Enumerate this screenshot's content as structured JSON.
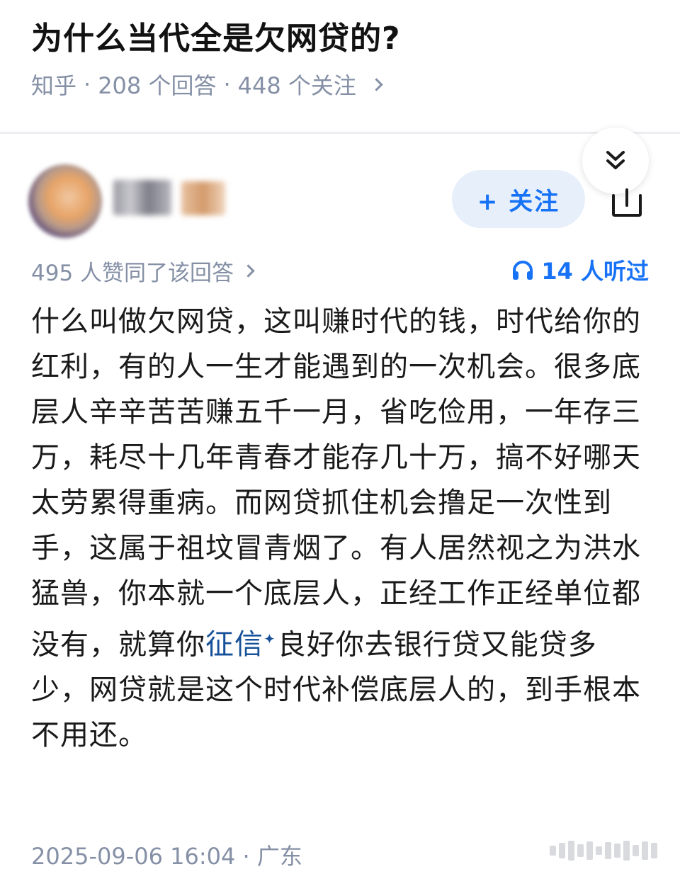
{
  "question": {
    "title": "为什么当代全是欠网贷的?",
    "source": "知乎",
    "answers": "208 个回答",
    "followers": "448 个关注"
  },
  "author": {
    "follow_label": "+ 关注"
  },
  "answer": {
    "votes": "495 人赞同了该回答",
    "listens": "14 人听过",
    "body_part1": "什么叫做欠网贷，这叫赚时代的钱，时代给你的红利，有的人一生才能遇到的一次机会。很多底层人辛辛苦苦赚五千一月，省吃俭用，一年存三万，耗尽十几年青春才能存几十万，搞不好哪天太劳累得重病。而网贷抓住机会撸足一次性到手，这属于祖坟冒青烟了。有人居然视之为洪水猛兽，你本就一个底层人，正经工作正经单位都没有，就算你",
    "keyword": "征信",
    "body_part2": "良好你去银行贷又能贷多少，网贷就是这个时代补偿底层人的，到手根本不用还。",
    "date": "2025-09-06 16:04",
    "location": "广东"
  },
  "colors": {
    "accent": "#1772f6",
    "meta": "#8590a6",
    "link": "#175199"
  },
  "icons": {
    "collapse": "double-chevron-down-icon",
    "share": "share-icon",
    "headphones": "headphones-icon"
  }
}
